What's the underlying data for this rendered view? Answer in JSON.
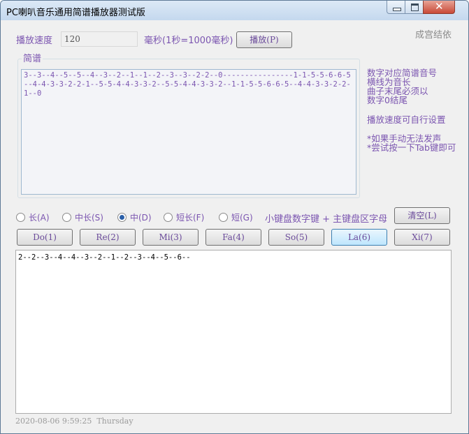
{
  "window": {
    "title": "PC喇叭音乐通用简谱播放器测试版"
  },
  "speed": {
    "label": "播放速度",
    "value": "120",
    "unit_note": "毫秒(1秒=1000毫秒)",
    "play_button": "播放(P)"
  },
  "signature": "成宫结依",
  "score": {
    "group_label": "简谱",
    "text": "3--3--4--5--5--4--3--2--1--1--2--3--3--2-2--0----------------1-1-5-5-6-6-5--4-4-3-3-2-2-1--5-5-4-4-3-3-2--5-5-4-4-3-3-2--1-1-5-5-6-6-5--4-4-3-3-2-2-1--0"
  },
  "notes": {
    "line1": "数字对应简谱音号",
    "line2": "横线为音长",
    "line3": "曲子末尾必须以",
    "line4": "数字0结尾",
    "line5": "播放速度可自行设置",
    "line6": "*如果手动无法发声",
    "line7": "*尝试按一下Tab键即可"
  },
  "durations": {
    "options": [
      {
        "label": "长(A)",
        "selected": false
      },
      {
        "label": "中长(S)",
        "selected": false
      },
      {
        "label": "中(D)",
        "selected": true
      },
      {
        "label": "短长(F)",
        "selected": false
      },
      {
        "label": "短(G)",
        "selected": false
      }
    ],
    "hint": "小键盘数字键 + 主键盘区字母",
    "clear_button": "清空(L)"
  },
  "note_buttons": [
    "Do(1)",
    "Re(2)",
    "Mi(3)",
    "Fa(4)",
    "So(5)",
    "La(6)",
    "Xi(7)"
  ],
  "output": {
    "text": "2--2--3--4--4--3--2--1--2--3--4--5--6--"
  },
  "status": {
    "date": "2020-08-06",
    "time": "9:59:25",
    "weekday": "Thursday"
  }
}
